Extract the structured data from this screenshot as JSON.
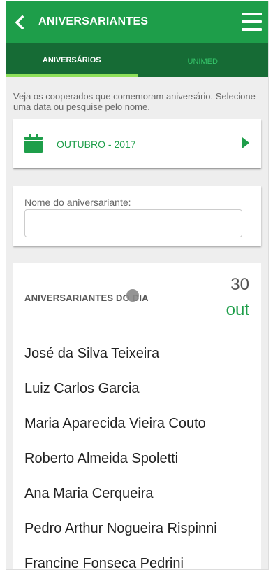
{
  "header": {
    "title": "ANIVERSARIANTES",
    "back_icon": "chevron-left-icon",
    "menu_icon": "hamburger-menu-icon"
  },
  "tabs": [
    {
      "label": "ANIVERSÁRIOS",
      "active": true
    },
    {
      "label": "UNIMED",
      "active": false
    }
  ],
  "intro_text": "Veja os cooperados que comemoram aniversário. Selecione uma data ou pesquise pelo nome.",
  "date_selector": {
    "icon": "calendar-icon",
    "label": "OUTUBRO - 2017",
    "next_icon": "caret-right-icon"
  },
  "search": {
    "label": "Nome do aniversariante:",
    "value": "",
    "placeholder": ""
  },
  "birthdays": {
    "title": "ANIVERSARIANTES DO DIA",
    "day": "30",
    "month": "out",
    "names": [
      "José da Silva Teixeira",
      "Luiz Carlos Garcia",
      "Maria Aparecida Vieira Couto",
      "Roberto Almeida Spoletti",
      "Ana Maria Cerqueira",
      "Pedro Arthur Nogueira Rispinni",
      "Francine Fonseca Pedrini"
    ]
  },
  "colors": {
    "primary": "#1e9e4a",
    "tab_bar": "#166b35",
    "tab_indicator": "#8ee05a",
    "background": "#eeeeee"
  }
}
